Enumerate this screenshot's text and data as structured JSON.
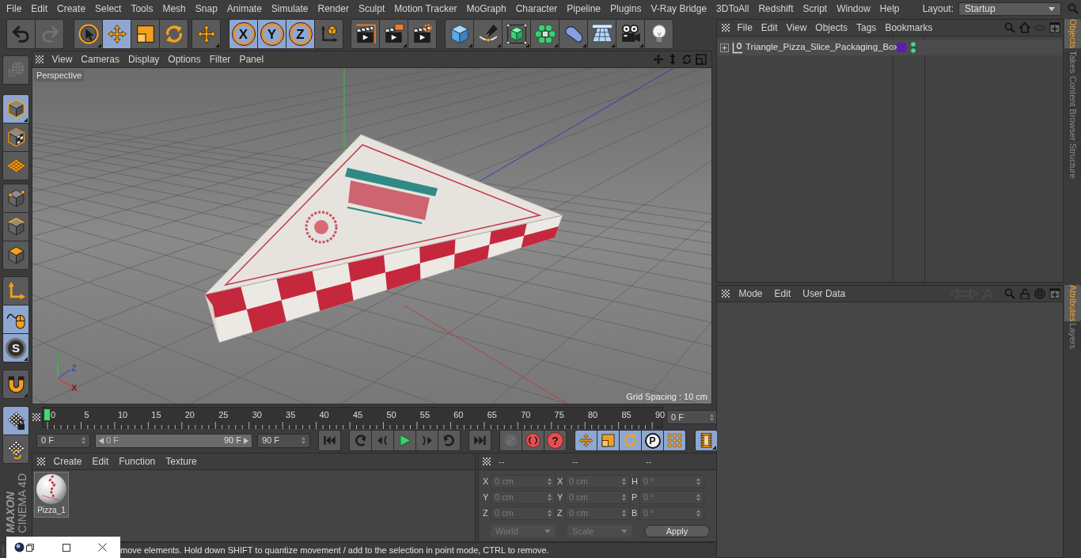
{
  "menu_bar": {
    "items": [
      "File",
      "Edit",
      "Create",
      "Select",
      "Tools",
      "Mesh",
      "Snap",
      "Animate",
      "Simulate",
      "Render",
      "Sculpt",
      "Motion Tracker",
      "MoGraph",
      "Character",
      "Pipeline",
      "Plugins",
      "V-Ray Bridge",
      "3DToAll",
      "Redshift",
      "Script",
      "Window",
      "Help"
    ],
    "layout_label": "Layout:",
    "layout_value": "Startup"
  },
  "toolbar": {
    "groups": [
      [
        {
          "kind": "undo",
          "selected": false,
          "disabled": false,
          "submenu": false
        },
        {
          "kind": "redo",
          "selected": false,
          "disabled": true,
          "submenu": false
        }
      ],
      [
        {
          "kind": "live_select",
          "selected": false,
          "disabled": false,
          "submenu": true
        },
        {
          "kind": "move",
          "selected": true,
          "disabled": false,
          "submenu": false
        },
        {
          "kind": "scale",
          "selected": false,
          "disabled": false,
          "submenu": false
        },
        {
          "kind": "rotate",
          "selected": false,
          "disabled": false,
          "submenu": false
        }
      ],
      [
        {
          "kind": "move",
          "selected": false,
          "disabled": false,
          "submenu": true
        }
      ],
      [
        {
          "kind": "axis",
          "label": "X",
          "selected": true,
          "disabled": false,
          "submenu": false
        },
        {
          "kind": "axis",
          "label": "Y",
          "selected": true,
          "disabled": false,
          "submenu": false
        },
        {
          "kind": "axis",
          "label": "Z",
          "selected": true,
          "disabled": false,
          "submenu": false
        },
        {
          "kind": "coord_system",
          "selected": false,
          "disabled": false,
          "submenu": false
        }
      ],
      [
        {
          "kind": "render_view",
          "selected": false,
          "disabled": false,
          "submenu": false
        },
        {
          "kind": "render_picture",
          "selected": false,
          "disabled": false,
          "submenu": true
        },
        {
          "kind": "render_settings",
          "selected": false,
          "disabled": false,
          "submenu": false
        }
      ],
      [
        {
          "kind": "cube",
          "selected": false,
          "disabled": false,
          "submenu": true
        },
        {
          "kind": "pen",
          "selected": false,
          "disabled": false,
          "submenu": true
        },
        {
          "kind": "subdivide",
          "selected": false,
          "disabled": false,
          "submenu": true
        },
        {
          "kind": "cloner",
          "selected": false,
          "disabled": false,
          "submenu": true
        },
        {
          "kind": "deformer",
          "selected": false,
          "disabled": false,
          "submenu": true
        },
        {
          "kind": "floor",
          "selected": false,
          "disabled": false,
          "submenu": true
        },
        {
          "kind": "camera",
          "selected": false,
          "disabled": false,
          "submenu": true
        },
        {
          "kind": "light",
          "selected": false,
          "disabled": false,
          "submenu": false
        }
      ]
    ]
  },
  "left_toolbar": {
    "groups": [
      [
        {
          "kind": "globe",
          "selected": false,
          "disabled": true,
          "submenu": false
        }
      ],
      [
        {
          "kind": "model",
          "selected": true,
          "disabled": false,
          "submenu": true
        },
        {
          "kind": "texture",
          "selected": false,
          "disabled": false,
          "submenu": false
        },
        {
          "kind": "workplane",
          "selected": false,
          "disabled": false,
          "submenu": false
        }
      ],
      [
        {
          "kind": "points",
          "selected": false,
          "disabled": false,
          "submenu": false
        },
        {
          "kind": "edges",
          "selected": false,
          "disabled": false,
          "submenu": false
        },
        {
          "kind": "polygons",
          "selected": false,
          "disabled": false,
          "submenu": false
        }
      ],
      [
        {
          "kind": "axis_mode",
          "selected": false,
          "disabled": false,
          "submenu": false
        },
        {
          "kind": "tweak",
          "selected": true,
          "disabled": false,
          "submenu": false
        },
        {
          "kind": "solo",
          "label": "S",
          "selected": true,
          "disabled": false,
          "submenu": true
        }
      ],
      [
        {
          "kind": "snap",
          "selected": false,
          "disabled": false,
          "submenu": true
        }
      ],
      [
        {
          "kind": "grid_lock",
          "selected": true,
          "disabled": false,
          "submenu": false
        },
        {
          "kind": "grid_sync",
          "selected": false,
          "disabled": false,
          "submenu": false
        }
      ]
    ]
  },
  "logo": {
    "vendor": "MAXON",
    "product": "CINEMA 4D"
  },
  "viewport": {
    "menu": [
      "View",
      "Cameras",
      "Display",
      "Options",
      "Filter",
      "Panel"
    ],
    "camera": "Perspective",
    "grid_spacing": "Grid Spacing : 10 cm",
    "gizmo_labels": [
      "Y",
      "Z",
      "X"
    ]
  },
  "timeline": {
    "ticks": [
      "0",
      "5",
      "10",
      "15",
      "20",
      "25",
      "30",
      "35",
      "40",
      "45",
      "50",
      "55",
      "60",
      "65",
      "70",
      "75",
      "80",
      "85",
      "90"
    ],
    "playhead": {
      "level": 0
    },
    "frame_field": "0 F"
  },
  "transport": {
    "start_field": "0 F",
    "range": {
      "start": "0 F",
      "end": "90 F",
      "level": 1
    },
    "end_field": "90 F",
    "groups": [
      [
        {
          "kind": "go_start",
          "selected": false,
          "disabled": false,
          "submenu": false
        }
      ],
      [
        {
          "kind": "prev_key",
          "selected": false,
          "disabled": false,
          "submenu": false
        },
        {
          "kind": "prev_frame",
          "selected": false,
          "disabled": false,
          "submenu": false
        },
        {
          "kind": "play",
          "selected": false,
          "disabled": false,
          "submenu": false
        },
        {
          "kind": "next_frame",
          "selected": false,
          "disabled": false,
          "submenu": false
        },
        {
          "kind": "next_key",
          "selected": false,
          "disabled": false,
          "submenu": false
        }
      ],
      [
        {
          "kind": "go_end",
          "selected": false,
          "disabled": false,
          "submenu": false
        }
      ],
      [
        {
          "kind": "keyframe",
          "selected": false,
          "disabled": true,
          "submenu": false
        },
        {
          "kind": "record",
          "selected": false,
          "disabled": false,
          "submenu": false
        },
        {
          "kind": "autokey",
          "label": "?",
          "selected": false,
          "disabled": false,
          "submenu": false
        }
      ],
      [
        {
          "kind": "key_move",
          "selected": true,
          "disabled": false,
          "submenu": false
        },
        {
          "kind": "key_scale",
          "selected": true,
          "disabled": false,
          "submenu": false
        },
        {
          "kind": "key_rotate",
          "selected": true,
          "disabled": false,
          "submenu": false
        },
        {
          "kind": "key_param",
          "label": "P",
          "selected": true,
          "disabled": false,
          "submenu": false
        },
        {
          "kind": "key_pla",
          "selected": true,
          "disabled": false,
          "submenu": false
        }
      ],
      [
        {
          "kind": "film",
          "selected": true,
          "disabled": false,
          "submenu": true
        }
      ]
    ]
  },
  "material_manager": {
    "menu": [
      "Create",
      "Edit",
      "Function",
      "Texture"
    ],
    "materials": [
      {
        "name": "Pizza_1"
      }
    ]
  },
  "coordinates": {
    "headers": [
      "--",
      "--",
      "--"
    ],
    "rows": [
      [
        {
          "axis": "X",
          "value": "0 cm",
          "disabled": true
        },
        {
          "axis": "X",
          "value": "0 cm",
          "disabled": true
        },
        {
          "axis": "H",
          "value": "0 °",
          "disabled": true
        }
      ],
      [
        {
          "axis": "Y",
          "value": "0 cm",
          "disabled": true
        },
        {
          "axis": "Y",
          "value": "0 cm",
          "disabled": true
        },
        {
          "axis": "P",
          "value": "0 °",
          "disabled": true
        }
      ],
      [
        {
          "axis": "Z",
          "value": "0 cm",
          "disabled": true
        },
        {
          "axis": "Z",
          "value": "0 cm",
          "disabled": true
        },
        {
          "axis": "B",
          "value": "0 °",
          "disabled": true
        }
      ]
    ],
    "dropdowns": [
      {
        "value": "World",
        "disabled": true
      },
      {
        "value": "Scale",
        "disabled": true
      }
    ],
    "apply": "Apply"
  },
  "status_bar": {
    "text": "move elements. Hold down SHIFT to quantize movement / add to the selection in point mode, CTRL to remove."
  },
  "object_manager": {
    "menu": [
      "File",
      "Edit",
      "View",
      "Objects",
      "Tags",
      "Bookmarks"
    ],
    "objects": [
      {
        "name": "Triangle_Pizza_Slice_Packaging_Box",
        "expanded": false
      }
    ]
  },
  "attribute_manager": {
    "menu": [
      "Mode",
      "Edit",
      "User Data"
    ]
  },
  "side_tabs": {
    "upper": [
      {
        "label": "Objects",
        "selected": true
      },
      {
        "label": "Takes",
        "selected": false
      },
      {
        "label": "Content Browser",
        "selected": false
      },
      {
        "label": "Structure",
        "selected": false
      }
    ],
    "lower": [
      {
        "label": "Attributes",
        "selected": true
      },
      {
        "label": "Layers",
        "selected": false
      }
    ]
  }
}
